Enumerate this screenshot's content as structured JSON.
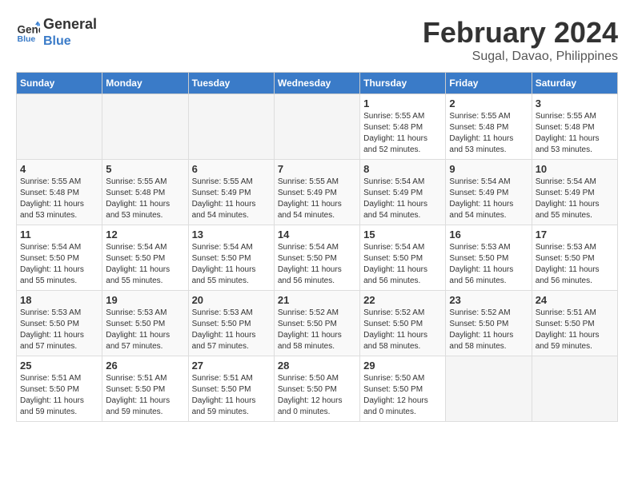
{
  "header": {
    "logo_line1": "General",
    "logo_line2": "Blue",
    "main_title": "February 2024",
    "subtitle": "Sugal, Davao, Philippines"
  },
  "calendar": {
    "days_of_week": [
      "Sunday",
      "Monday",
      "Tuesday",
      "Wednesday",
      "Thursday",
      "Friday",
      "Saturday"
    ],
    "weeks": [
      [
        {
          "day": "",
          "info": ""
        },
        {
          "day": "",
          "info": ""
        },
        {
          "day": "",
          "info": ""
        },
        {
          "day": "",
          "info": ""
        },
        {
          "day": "1",
          "info": "Sunrise: 5:55 AM\nSunset: 5:48 PM\nDaylight: 11 hours\nand 52 minutes."
        },
        {
          "day": "2",
          "info": "Sunrise: 5:55 AM\nSunset: 5:48 PM\nDaylight: 11 hours\nand 53 minutes."
        },
        {
          "day": "3",
          "info": "Sunrise: 5:55 AM\nSunset: 5:48 PM\nDaylight: 11 hours\nand 53 minutes."
        }
      ],
      [
        {
          "day": "4",
          "info": "Sunrise: 5:55 AM\nSunset: 5:48 PM\nDaylight: 11 hours\nand 53 minutes."
        },
        {
          "day": "5",
          "info": "Sunrise: 5:55 AM\nSunset: 5:48 PM\nDaylight: 11 hours\nand 53 minutes."
        },
        {
          "day": "6",
          "info": "Sunrise: 5:55 AM\nSunset: 5:49 PM\nDaylight: 11 hours\nand 54 minutes."
        },
        {
          "day": "7",
          "info": "Sunrise: 5:55 AM\nSunset: 5:49 PM\nDaylight: 11 hours\nand 54 minutes."
        },
        {
          "day": "8",
          "info": "Sunrise: 5:54 AM\nSunset: 5:49 PM\nDaylight: 11 hours\nand 54 minutes."
        },
        {
          "day": "9",
          "info": "Sunrise: 5:54 AM\nSunset: 5:49 PM\nDaylight: 11 hours\nand 54 minutes."
        },
        {
          "day": "10",
          "info": "Sunrise: 5:54 AM\nSunset: 5:49 PM\nDaylight: 11 hours\nand 55 minutes."
        }
      ],
      [
        {
          "day": "11",
          "info": "Sunrise: 5:54 AM\nSunset: 5:50 PM\nDaylight: 11 hours\nand 55 minutes."
        },
        {
          "day": "12",
          "info": "Sunrise: 5:54 AM\nSunset: 5:50 PM\nDaylight: 11 hours\nand 55 minutes."
        },
        {
          "day": "13",
          "info": "Sunrise: 5:54 AM\nSunset: 5:50 PM\nDaylight: 11 hours\nand 55 minutes."
        },
        {
          "day": "14",
          "info": "Sunrise: 5:54 AM\nSunset: 5:50 PM\nDaylight: 11 hours\nand 56 minutes."
        },
        {
          "day": "15",
          "info": "Sunrise: 5:54 AM\nSunset: 5:50 PM\nDaylight: 11 hours\nand 56 minutes."
        },
        {
          "day": "16",
          "info": "Sunrise: 5:53 AM\nSunset: 5:50 PM\nDaylight: 11 hours\nand 56 minutes."
        },
        {
          "day": "17",
          "info": "Sunrise: 5:53 AM\nSunset: 5:50 PM\nDaylight: 11 hours\nand 56 minutes."
        }
      ],
      [
        {
          "day": "18",
          "info": "Sunrise: 5:53 AM\nSunset: 5:50 PM\nDaylight: 11 hours\nand 57 minutes."
        },
        {
          "day": "19",
          "info": "Sunrise: 5:53 AM\nSunset: 5:50 PM\nDaylight: 11 hours\nand 57 minutes."
        },
        {
          "day": "20",
          "info": "Sunrise: 5:53 AM\nSunset: 5:50 PM\nDaylight: 11 hours\nand 57 minutes."
        },
        {
          "day": "21",
          "info": "Sunrise: 5:52 AM\nSunset: 5:50 PM\nDaylight: 11 hours\nand 58 minutes."
        },
        {
          "day": "22",
          "info": "Sunrise: 5:52 AM\nSunset: 5:50 PM\nDaylight: 11 hours\nand 58 minutes."
        },
        {
          "day": "23",
          "info": "Sunrise: 5:52 AM\nSunset: 5:50 PM\nDaylight: 11 hours\nand 58 minutes."
        },
        {
          "day": "24",
          "info": "Sunrise: 5:51 AM\nSunset: 5:50 PM\nDaylight: 11 hours\nand 59 minutes."
        }
      ],
      [
        {
          "day": "25",
          "info": "Sunrise: 5:51 AM\nSunset: 5:50 PM\nDaylight: 11 hours\nand 59 minutes."
        },
        {
          "day": "26",
          "info": "Sunrise: 5:51 AM\nSunset: 5:50 PM\nDaylight: 11 hours\nand 59 minutes."
        },
        {
          "day": "27",
          "info": "Sunrise: 5:51 AM\nSunset: 5:50 PM\nDaylight: 11 hours\nand 59 minutes."
        },
        {
          "day": "28",
          "info": "Sunrise: 5:50 AM\nSunset: 5:50 PM\nDaylight: 12 hours\nand 0 minutes."
        },
        {
          "day": "29",
          "info": "Sunrise: 5:50 AM\nSunset: 5:50 PM\nDaylight: 12 hours\nand 0 minutes."
        },
        {
          "day": "",
          "info": ""
        },
        {
          "day": "",
          "info": ""
        }
      ]
    ]
  }
}
